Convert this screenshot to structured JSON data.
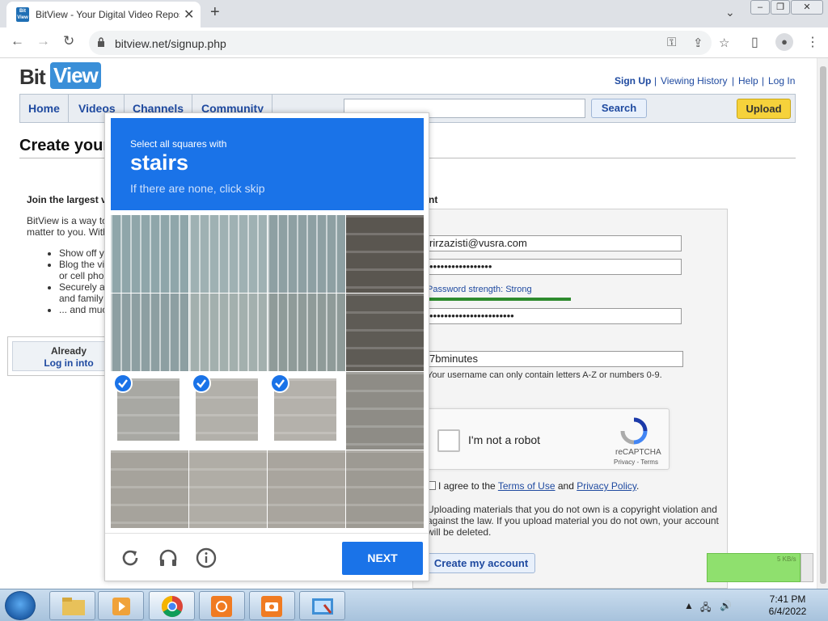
{
  "browser": {
    "tab_title": "BitView - Your Digital Video Repository",
    "tab_favicon": "Bit View",
    "url": "bitview.net/signup.php",
    "icons": [
      "back-icon",
      "forward-icon",
      "reload-icon",
      "lock-icon",
      "key-icon",
      "share-icon",
      "star-icon",
      "sidebar-icon",
      "profile-icon",
      "menu-icon"
    ]
  },
  "site": {
    "logo_bit": "Bit",
    "logo_view": "View",
    "top_links": [
      "Sign Up",
      "Viewing History",
      "Help",
      "Log In"
    ],
    "separator": "|",
    "nav": [
      "Home",
      "Videos",
      "Channels",
      "Community"
    ],
    "search_button": "Search",
    "upload_button": "Upload",
    "page_title": "Create your BitView Account",
    "join_heading": "Join the largest v",
    "join_text_lines": [
      "BitView is a way to",
      "matter to you. With"
    ],
    "join_list": [
      "Show off y",
      "Blog the vi",
      "or cell pho",
      "Securely a",
      "and family",
      "... and muc"
    ],
    "already_line1": "Already",
    "already_line2": "Log in into",
    "right_heading": "nt"
  },
  "form": {
    "email": "rirzazisti@vusra.com",
    "password": "•••••••••••••••••",
    "password_strength": "Password strength: Strong",
    "password_strength_level": 1.0,
    "confirm_password": "•••••••••••••••••••••••",
    "username": "7bminutes",
    "username_hint": "Your username can only contain letters A-Z or numbers 0-9.",
    "recaptcha_label": "I'm not a robot",
    "recaptcha_brand": "reCAPTCHA",
    "recaptcha_terms": "Privacy - Terms",
    "agree_prefix": "I agree to the",
    "terms_link": "Terms of Use",
    "agree_and": "and",
    "privacy_link": "Privacy Policy",
    "agree_suffix": ".",
    "warning": "Uploading materials that you do not own is a copyright violation and against the law. If you upload material you do not own, your account will be deleted.",
    "create_button": "Create my account"
  },
  "captcha": {
    "instruction": "Select all squares with",
    "keyword": "stairs",
    "skip_hint": "If there are none, click skip",
    "selected_tiles": [
      8,
      9,
      10
    ],
    "next_button": "NEXT",
    "icons": [
      "reload-icon",
      "headphones-icon",
      "info-icon"
    ],
    "colors": {
      "accent": "#1a73e8",
      "check": "#1a73e8"
    }
  },
  "widget": {
    "value": "5 KB/s"
  },
  "taskbar": {
    "apps": [
      "file-explorer-icon",
      "media-player-icon",
      "chrome-icon",
      "orange-app-icon",
      "camera-app-icon",
      "snipping-tool-icon"
    ],
    "active_app": "chrome-icon",
    "time": "7:41 PM",
    "date": "6/4/2022"
  }
}
